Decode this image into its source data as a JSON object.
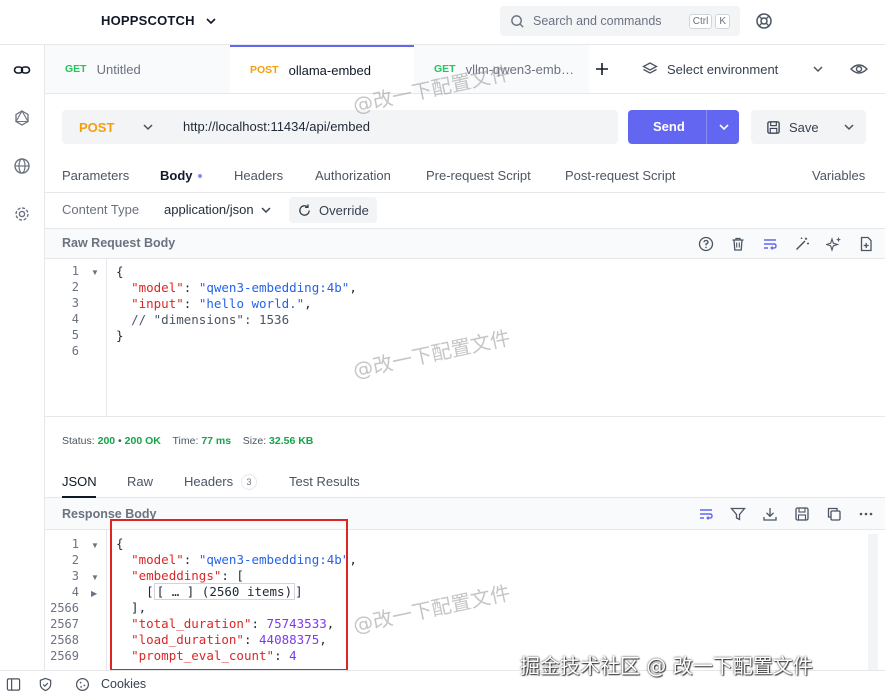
{
  "header": {
    "brand": "HOPPSCOTCH",
    "search_placeholder": "Search and commands",
    "shortcut_keys": [
      "Ctrl",
      "K"
    ]
  },
  "tabs": [
    {
      "method": "GET",
      "label": "Untitled",
      "method_color": "#22c55e",
      "active": false
    },
    {
      "method": "POST",
      "label": "ollama-embed",
      "method_color": "#f59e0b",
      "active": true
    },
    {
      "method": "GET",
      "label": "vllm-qwen3-emb…",
      "method_color": "#22c55e",
      "active": false
    }
  ],
  "environment": {
    "label": "Select environment"
  },
  "request": {
    "method": "POST",
    "url": "http://localhost:11434/api/embed",
    "send_label": "Send",
    "save_label": "Save",
    "tabs": [
      "Parameters",
      "Body",
      "Headers",
      "Authorization",
      "Pre-request Script",
      "Post-request Script"
    ],
    "active_tab": "Body",
    "variables_label": "Variables",
    "content_type_label": "Content Type",
    "content_type_value": "application/json",
    "override_label": "Override",
    "raw_body_label": "Raw Request Body",
    "body_lines": [
      "1",
      "2",
      "3",
      "4",
      "5",
      "6"
    ],
    "body": {
      "model_key": "\"model\"",
      "model_value": "\"qwen3-embedding:4b\"",
      "input_key": "\"input\"",
      "input_value": "\"hello world.\"",
      "comment": "// \"dimensions\": 1536"
    }
  },
  "status": {
    "status_label": "Status:",
    "status_code": "200",
    "status_text": "200 OK",
    "time_label": "Time:",
    "time_value": "77 ms",
    "size_label": "Size:",
    "size_value": "32.56 KB"
  },
  "response": {
    "tabs": [
      "JSON",
      "Raw",
      "Headers",
      "Test Results"
    ],
    "active_tab": "JSON",
    "headers_count": "3",
    "body_label": "Response Body",
    "lines": [
      "1",
      "2",
      "3",
      "4",
      "2566",
      "2567",
      "2568",
      "2569"
    ],
    "body": {
      "model_key": "\"model\"",
      "model_value": "\"qwen3-embedding:4b\"",
      "embeddings_key": "\"embeddings\"",
      "collapsed": "[ … ] (2560 items)",
      "total_duration_key": "\"total_duration\"",
      "total_duration_value": "75743533",
      "load_duration_key": "\"load_duration\"",
      "load_duration_value": "44088375",
      "prompt_eval_count_key": "\"prompt_eval_count\"",
      "prompt_eval_count_value": "4"
    }
  },
  "footer": {
    "cookies_label": "Cookies"
  },
  "watermark": {
    "text": "@改一下配置文件",
    "bottom_text": "掘金技术社区 @ 改一下配置文件"
  },
  "colors": {
    "accent": "#6366f1",
    "post": "#f59e0b",
    "get": "#22c55e",
    "success": "#16a34a",
    "highlight_box": "#dc2626"
  }
}
